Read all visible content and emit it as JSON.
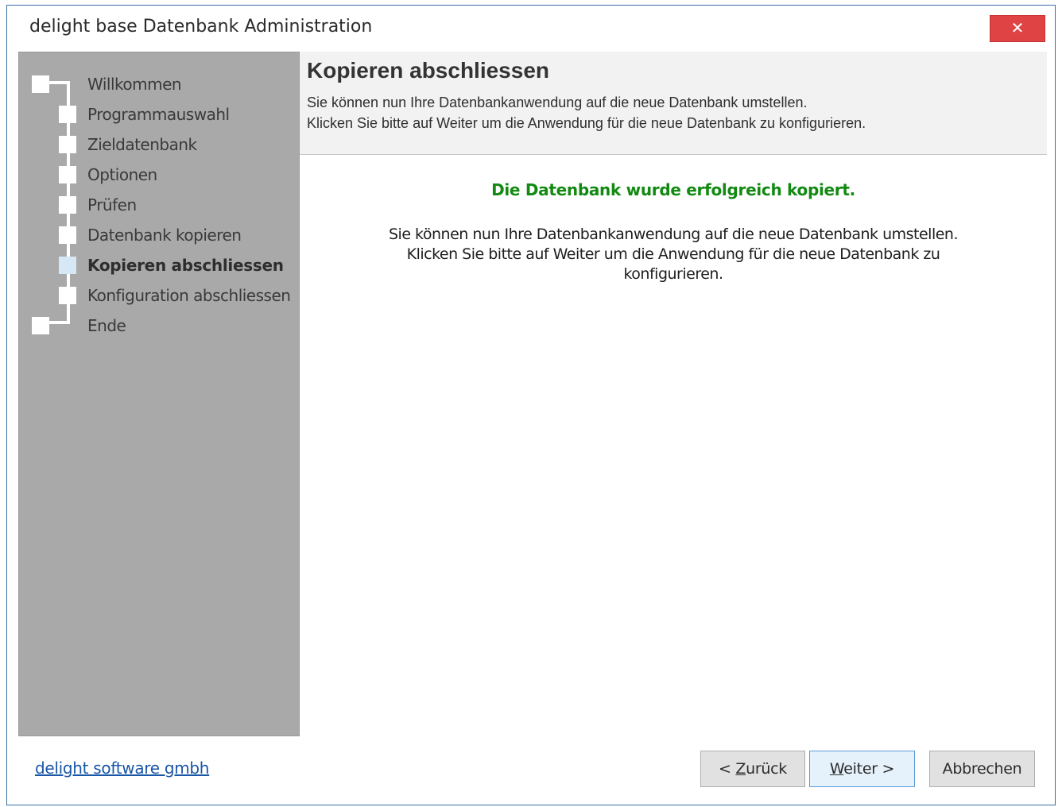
{
  "window": {
    "title": "delight base Datenbank Administration",
    "close_label": "✕"
  },
  "sidebar": {
    "steps": [
      {
        "label": "Willkommen"
      },
      {
        "label": "Programmauswahl"
      },
      {
        "label": "Zieldatenbank"
      },
      {
        "label": "Optionen"
      },
      {
        "label": "Prüfen"
      },
      {
        "label": "Datenbank kopieren"
      },
      {
        "label": "Kopieren abschliessen",
        "active": true
      },
      {
        "label": "Konfiguration abschliessen"
      },
      {
        "label": "Ende"
      }
    ]
  },
  "header": {
    "title": "Kopieren abschliessen",
    "line1": "Sie können nun Ihre Datenbankanwendung auf die neue Datenbank umstellen.",
    "line2": "Klicken Sie bitte auf Weiter um die Anwendung für die neue Datenbank zu konfigurieren."
  },
  "content": {
    "success_message": "Die Datenbank wurde erfolgreich kopiert.",
    "info_line1": "Sie können nun Ihre Datenbankanwendung auf die neue Datenbank umstellen.",
    "info_line2": "Klicken Sie bitte auf Weiter um die Anwendung für die neue Datenbank zu",
    "info_line3": "konfigurieren."
  },
  "footer": {
    "company_link": "delight software gmbh",
    "back_prefix": "< ",
    "back_hotkey": "Z",
    "back_rest": "urück",
    "next_hotkey": "W",
    "next_rest": "eiter >",
    "cancel_label": "Abbrechen"
  },
  "colors": {
    "success": "#128a12",
    "sidebar_bg": "#a9a9a9",
    "close_bg": "#e04343",
    "link": "#1a56a8"
  }
}
